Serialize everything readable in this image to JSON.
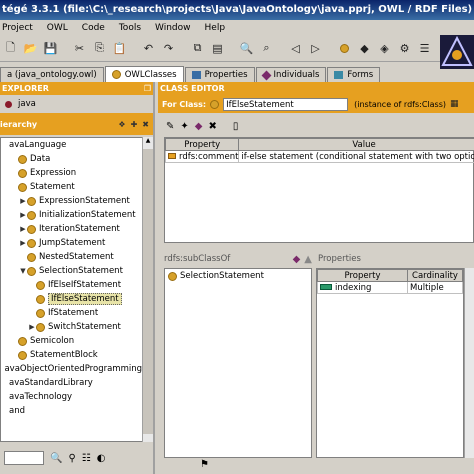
{
  "window": {
    "title": "tégé 3.3.1   (file:\\C:\\_research\\projects\\Java\\JavaOntology\\java.pprj, OWL / RDF Files)"
  },
  "menu": [
    "Project",
    "OWL",
    "Code",
    "Tools",
    "Window",
    "Help"
  ],
  "tabs": [
    {
      "label": "a (java_ontology.owl)",
      "active": false
    },
    {
      "label": "OWLClasses",
      "active": true
    },
    {
      "label": "Properties",
      "active": false
    },
    {
      "label": "Individuals",
      "active": false
    },
    {
      "label": "Forms",
      "active": false
    }
  ],
  "explorer": {
    "title": "EXPLORER",
    "root_item": "java",
    "hierarchy_label": "ierarchy",
    "items": [
      {
        "label": "avaLanguage",
        "indent": 0,
        "icon": false,
        "toggle": ""
      },
      {
        "label": "Data",
        "indent": 1,
        "icon": true,
        "toggle": ""
      },
      {
        "label": "Expression",
        "indent": 1,
        "icon": true,
        "toggle": ""
      },
      {
        "label": "Statement",
        "indent": 1,
        "icon": true,
        "toggle": ""
      },
      {
        "label": "ExpressionStatement",
        "indent": 2,
        "icon": true,
        "toggle": "▶"
      },
      {
        "label": "InitializationStatement",
        "indent": 2,
        "icon": true,
        "toggle": "▶"
      },
      {
        "label": "IterationStatement",
        "indent": 2,
        "icon": true,
        "toggle": "▶"
      },
      {
        "label": "JumpStatement",
        "indent": 2,
        "icon": true,
        "toggle": "▶"
      },
      {
        "label": "NestedStatement",
        "indent": 2,
        "icon": true,
        "toggle": ""
      },
      {
        "label": "SelectionStatement",
        "indent": 2,
        "icon": true,
        "toggle": "▼"
      },
      {
        "label": "IfElseIfStatement",
        "indent": 3,
        "icon": true,
        "toggle": ""
      },
      {
        "label": "IfElseStatement",
        "indent": 3,
        "icon": true,
        "toggle": "",
        "selected": true
      },
      {
        "label": "IfStatement",
        "indent": 3,
        "icon": true,
        "toggle": ""
      },
      {
        "label": "SwitchStatement",
        "indent": 3,
        "icon": true,
        "toggle": "▶"
      },
      {
        "label": "Semicolon",
        "indent": 1,
        "icon": true,
        "toggle": ""
      },
      {
        "label": "StatementBlock",
        "indent": 1,
        "icon": true,
        "toggle": ""
      },
      {
        "label": "avaObjectOrientedProgramming",
        "indent": 0,
        "icon": false,
        "toggle": ""
      },
      {
        "label": "avaStandardLibrary",
        "indent": 0,
        "icon": false,
        "toggle": ""
      },
      {
        "label": "avaTechnology",
        "indent": 0,
        "icon": false,
        "toggle": ""
      },
      {
        "label": "and",
        "indent": 0,
        "icon": false,
        "toggle": ""
      }
    ]
  },
  "editor": {
    "title": "CLASS EDITOR",
    "for_class_label": "For Class:",
    "class_name": "IfElseStatement",
    "instance_of": "(instance of rdfs:Class)",
    "annotations": {
      "headers": [
        "Property",
        "Value"
      ],
      "rows": [
        {
          "property": "rdfs:comment",
          "value": "if-else  statement (conditional statement with two options)"
        }
      ]
    },
    "subclass_label": "rdfs:subClassOf",
    "superclasses": [
      "SelectionStatement"
    ],
    "properties_label": "Properties",
    "properties": {
      "headers": [
        "Property",
        "Cardinality"
      ],
      "rows": [
        {
          "property": "indexing",
          "cardinality": "Multiple"
        }
      ]
    }
  },
  "colors": {
    "header": "#e6a020",
    "class_icon": "#d6a12a",
    "titlebar": "#0a246a"
  }
}
